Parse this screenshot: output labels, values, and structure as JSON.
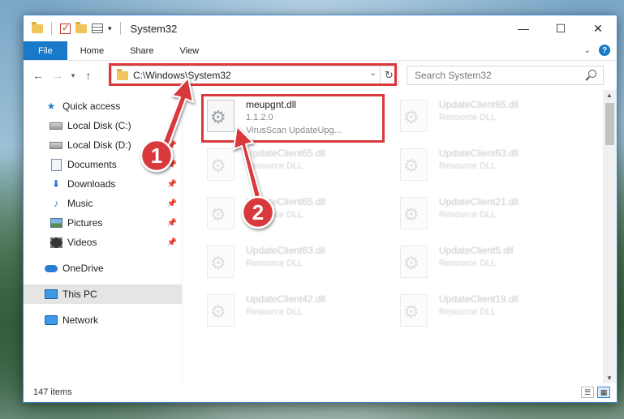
{
  "window": {
    "title": "System32"
  },
  "controls": {
    "minimize": "—",
    "maximize": "☐",
    "close": "✕"
  },
  "ribbon": {
    "tabs": [
      "File",
      "Home",
      "Share",
      "View"
    ]
  },
  "address": {
    "path": "C:\\Windows\\System32"
  },
  "search": {
    "placeholder": "Search System32"
  },
  "nav": {
    "quick_access": "Quick access",
    "items": [
      "Local Disk (C:)",
      "Local Disk (D:)",
      "Documents",
      "Downloads",
      "Music",
      "Pictures",
      "Videos"
    ],
    "onedrive": "OneDrive",
    "this_pc": "This PC",
    "network": "Network"
  },
  "files": [
    {
      "name": "meupgnt.dll",
      "line2": "1.1.2.0",
      "line3": "VirusScan UpdateUpg..."
    },
    {
      "name": "UpdateClient65.dll",
      "line2": "Resource DLL"
    },
    {
      "name": "UpdateClient65.dll",
      "line2": "Resource DLL"
    },
    {
      "name": "UpdateClient63.dll",
      "line2": "Resource DLL"
    },
    {
      "name": "UpdateClient65.dll",
      "line2": "Resource DLL"
    },
    {
      "name": "UpdateClient21.dll",
      "line2": "Resource DLL"
    },
    {
      "name": "UpdateClient63.dll",
      "line2": "Resource DLL"
    },
    {
      "name": "UpdateClient5.dll",
      "line2": "Resource DLL"
    },
    {
      "name": "UpdateClient42.dll",
      "line2": "Resource DLL"
    },
    {
      "name": "UpdateClient19.dll",
      "line2": "Resource DLL"
    }
  ],
  "status": {
    "items_count": "147 items"
  },
  "annotations": {
    "step1": "1",
    "step2": "2",
    "color": "#d9383c"
  }
}
